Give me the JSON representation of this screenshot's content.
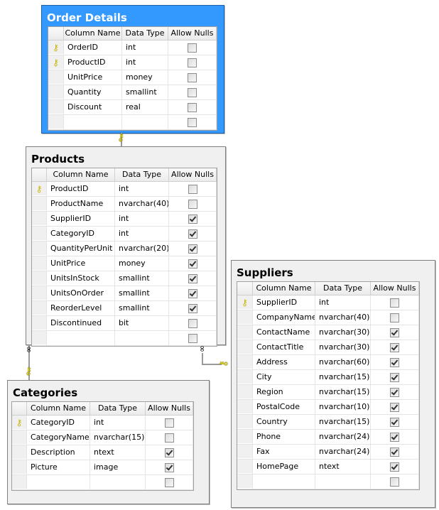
{
  "headers": {
    "name": "Column Name",
    "type": "Data Type",
    "nulls": "Allow Nulls"
  },
  "tables": [
    {
      "id": "order-details",
      "title": "Order Details",
      "selected": true,
      "columns": [
        {
          "name": "OrderID",
          "type": "int",
          "pk": true,
          "nulls": false
        },
        {
          "name": "ProductID",
          "type": "int",
          "pk": true,
          "nulls": false
        },
        {
          "name": "UnitPrice",
          "type": "money",
          "pk": false,
          "nulls": false
        },
        {
          "name": "Quantity",
          "type": "smallint",
          "pk": false,
          "nulls": false
        },
        {
          "name": "Discount",
          "type": "real",
          "pk": false,
          "nulls": false
        },
        {
          "name": "",
          "type": "",
          "pk": false,
          "nulls": false
        }
      ]
    },
    {
      "id": "products",
      "title": "Products",
      "selected": false,
      "columns": [
        {
          "name": "ProductID",
          "type": "int",
          "pk": true,
          "nulls": false
        },
        {
          "name": "ProductName",
          "type": "nvarchar(40)",
          "pk": false,
          "nulls": false
        },
        {
          "name": "SupplierID",
          "type": "int",
          "pk": false,
          "nulls": true
        },
        {
          "name": "CategoryID",
          "type": "int",
          "pk": false,
          "nulls": true
        },
        {
          "name": "QuantityPerUnit",
          "type": "nvarchar(20)",
          "pk": false,
          "nulls": true
        },
        {
          "name": "UnitPrice",
          "type": "money",
          "pk": false,
          "nulls": true
        },
        {
          "name": "UnitsInStock",
          "type": "smallint",
          "pk": false,
          "nulls": true
        },
        {
          "name": "UnitsOnOrder",
          "type": "smallint",
          "pk": false,
          "nulls": true
        },
        {
          "name": "ReorderLevel",
          "type": "smallint",
          "pk": false,
          "nulls": true
        },
        {
          "name": "Discontinued",
          "type": "bit",
          "pk": false,
          "nulls": false
        },
        {
          "name": "",
          "type": "",
          "pk": false,
          "nulls": false
        }
      ]
    },
    {
      "id": "suppliers",
      "title": "Suppliers",
      "selected": false,
      "columns": [
        {
          "name": "SupplierID",
          "type": "int",
          "pk": true,
          "nulls": false
        },
        {
          "name": "CompanyName",
          "type": "nvarchar(40)",
          "pk": false,
          "nulls": false
        },
        {
          "name": "ContactName",
          "type": "nvarchar(30)",
          "pk": false,
          "nulls": true
        },
        {
          "name": "ContactTitle",
          "type": "nvarchar(30)",
          "pk": false,
          "nulls": true
        },
        {
          "name": "Address",
          "type": "nvarchar(60)",
          "pk": false,
          "nulls": true
        },
        {
          "name": "City",
          "type": "nvarchar(15)",
          "pk": false,
          "nulls": true
        },
        {
          "name": "Region",
          "type": "nvarchar(15)",
          "pk": false,
          "nulls": true
        },
        {
          "name": "PostalCode",
          "type": "nvarchar(10)",
          "pk": false,
          "nulls": true
        },
        {
          "name": "Country",
          "type": "nvarchar(15)",
          "pk": false,
          "nulls": true
        },
        {
          "name": "Phone",
          "type": "nvarchar(24)",
          "pk": false,
          "nulls": true
        },
        {
          "name": "Fax",
          "type": "nvarchar(24)",
          "pk": false,
          "nulls": true
        },
        {
          "name": "HomePage",
          "type": "ntext",
          "pk": false,
          "nulls": true
        },
        {
          "name": "",
          "type": "",
          "pk": false,
          "nulls": false
        }
      ]
    },
    {
      "id": "categories",
      "title": "Categories",
      "selected": false,
      "columns": [
        {
          "name": "CategoryID",
          "type": "int",
          "pk": true,
          "nulls": false
        },
        {
          "name": "CategoryName",
          "type": "nvarchar(15)",
          "pk": false,
          "nulls": false
        },
        {
          "name": "Description",
          "type": "ntext",
          "pk": false,
          "nulls": true
        },
        {
          "name": "Picture",
          "type": "image",
          "pk": false,
          "nulls": true
        },
        {
          "name": "",
          "type": "",
          "pk": false,
          "nulls": false
        }
      ]
    }
  ]
}
